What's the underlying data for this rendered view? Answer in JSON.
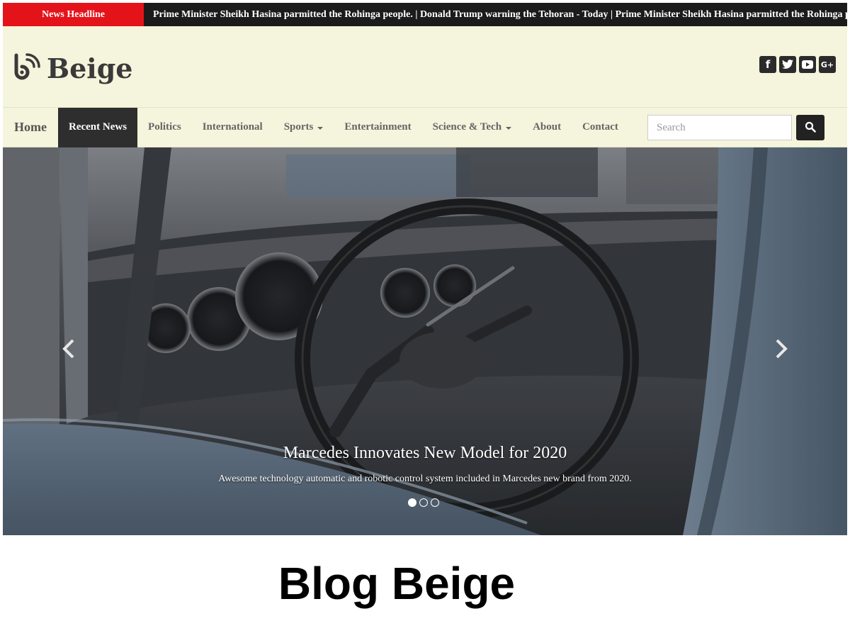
{
  "ticker": {
    "label": "News Headline",
    "text": "Prime Minister Sheikh Hasina parmitted the Rohinga people. | Donald Trump warning the Tehoran - Today | Prime Minister Sheikh Hasina parmitted the Rohinga people."
  },
  "header": {
    "brand_name": "Beige",
    "socials": [
      {
        "icon": "facebook-icon",
        "glyph": "f"
      },
      {
        "icon": "twitter-icon",
        "glyph": "t"
      },
      {
        "icon": "youtube-icon",
        "glyph": "▶"
      },
      {
        "icon": "google-plus-icon",
        "glyph": "G+"
      }
    ]
  },
  "nav": {
    "items": [
      {
        "label": "Home"
      },
      {
        "label": "Recent News"
      },
      {
        "label": "Politics"
      },
      {
        "label": "International"
      },
      {
        "label": "Sports"
      },
      {
        "label": "Entertainment"
      },
      {
        "label": "Science & Tech"
      },
      {
        "label": "About"
      },
      {
        "label": "Contact"
      }
    ],
    "search_placeholder": "Search"
  },
  "hero": {
    "title": "Marcedes Innovates New Model for 2020",
    "text": "Awesome technology automatic and robotic control system included in Marcedes new brand from 2020.",
    "slide_count": 3,
    "active_slide": 1
  },
  "footer": {
    "blog_title": "Blog Beige"
  },
  "colors": {
    "ticker_label_bg": "#e4131a",
    "ticker_bg": "#1b1b1b",
    "header_bg": "#f5f4dc",
    "nav_active_bg": "#2e2e2e"
  }
}
